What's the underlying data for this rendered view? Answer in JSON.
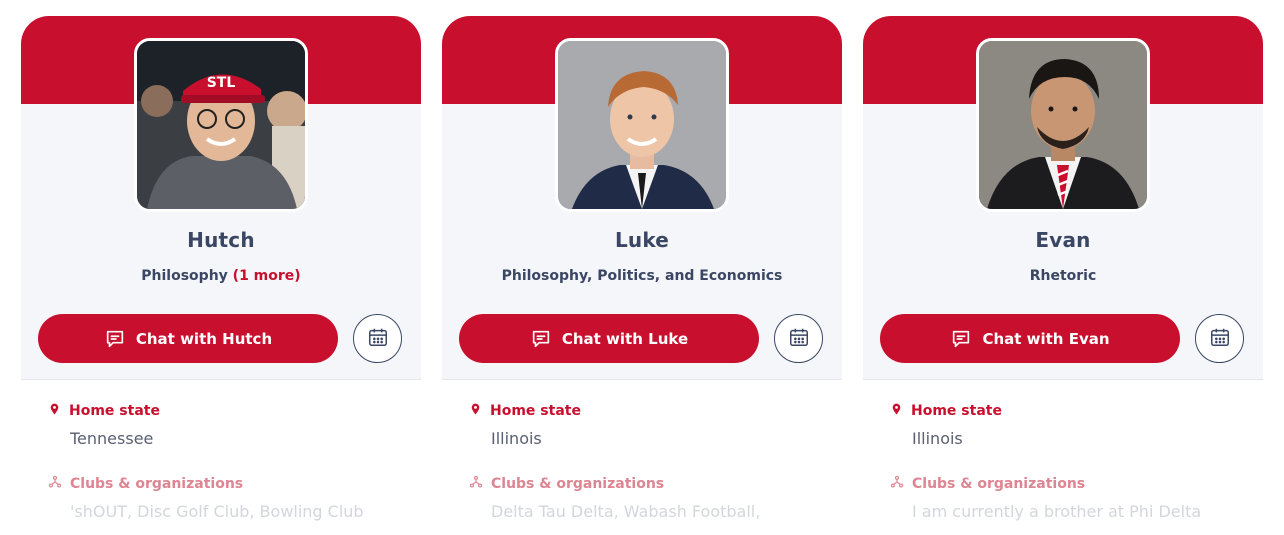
{
  "colors": {
    "accent": "#c8102e",
    "text": "#3a4663",
    "card_bg": "#f4f6f9"
  },
  "cards": [
    {
      "name": "Hutch",
      "major": "Philosophy",
      "more": "(1 more)",
      "chat_label": "Chat with Hutch",
      "home_state_label": "Home state",
      "home_state": "Tennessee",
      "clubs_label": "Clubs & organizations",
      "clubs": "'shOUT, Disc Golf Club, Bowling Club"
    },
    {
      "name": "Luke",
      "major": "Philosophy, Politics, and Economics",
      "chat_label": "Chat with Luke",
      "home_state_label": "Home state",
      "home_state": "Illinois",
      "clubs_label": "Clubs & organizations",
      "clubs": "Delta Tau Delta, Wabash Football,"
    },
    {
      "name": "Evan",
      "major": "Rhetoric",
      "chat_label": "Chat with Evan",
      "home_state_label": "Home state",
      "home_state": "Illinois",
      "clubs_label": "Clubs & organizations",
      "clubs": "I am currently a brother at Phi Delta"
    }
  ]
}
